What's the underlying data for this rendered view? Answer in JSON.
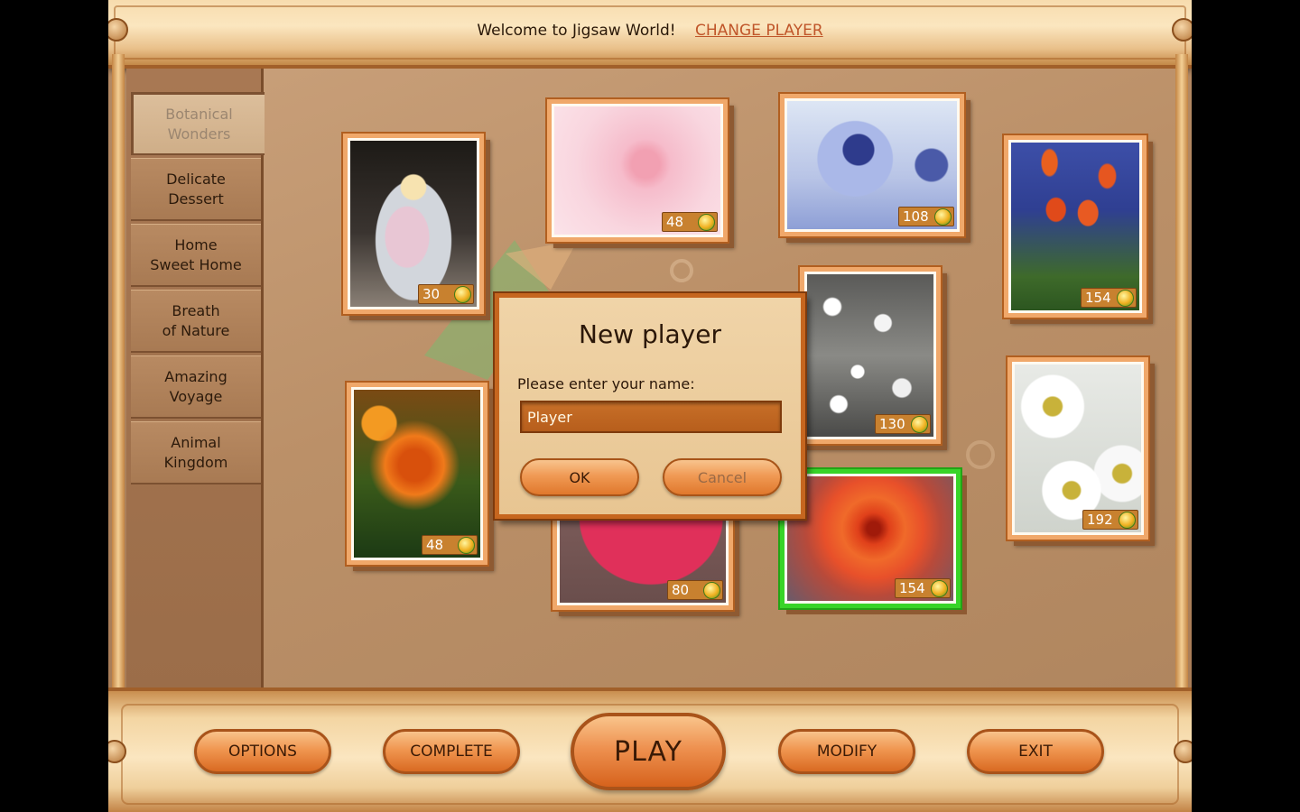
{
  "header": {
    "welcome_text": "Welcome to Jigsaw World!",
    "change_player_label": "CHANGE PLAYER"
  },
  "categories": [
    {
      "label": "Botanical\nWonders",
      "active": true
    },
    {
      "label": "Delicate\nDessert"
    },
    {
      "label": "Home\nSweet Home"
    },
    {
      "label": "Breath\nof Nature"
    },
    {
      "label": "Amazing\nVoyage"
    },
    {
      "label": "Animal\nKingdom"
    }
  ],
  "puzzles": [
    {
      "name": "candles",
      "pieces": "30"
    },
    {
      "name": "pink-rose",
      "pieces": "48"
    },
    {
      "name": "thistle",
      "pieces": "108"
    },
    {
      "name": "tulips",
      "pieces": "154"
    },
    {
      "name": "orange-rose",
      "pieces": "48"
    },
    {
      "name": "white-blossoms",
      "pieces": "130"
    },
    {
      "name": "daisies",
      "pieces": "192"
    },
    {
      "name": "petal-drops",
      "pieces": "80"
    },
    {
      "name": "dahlia",
      "pieces": "154",
      "selected": true
    }
  ],
  "dialog": {
    "title": "New player",
    "prompt": "Please enter your name:",
    "input_value": "Player",
    "ok_label": "OK",
    "cancel_label": "Cancel"
  },
  "toolbar": {
    "options_label": "OPTIONS",
    "complete_label": "COMPLETE",
    "play_label": "PLAY",
    "modify_label": "MODIFY",
    "exit_label": "EXIT"
  },
  "colors": {
    "selected_border": "#38d428",
    "accent_orange": "#f09a55",
    "count_badge": "#c8812f"
  }
}
